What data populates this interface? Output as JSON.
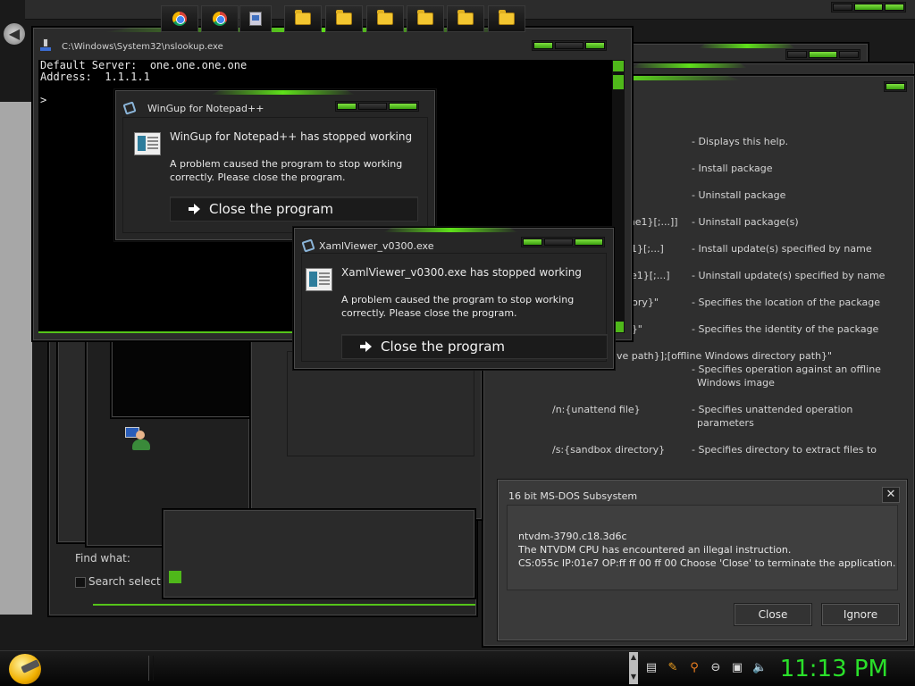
{
  "console": {
    "title": "C:\\Windows\\System32\\nslookup.exe",
    "lines": [
      "Default Server:  one.one.one.one",
      "Address:  1.1.1.1",
      "",
      ">"
    ]
  },
  "dialog1": {
    "title": "WinGup for Notepad++",
    "heading": "WinGup for Notepad++ has stopped working",
    "body1": "A problem caused the program to stop working",
    "body2": "correctly. Please close the program.",
    "button": "Close the program"
  },
  "dialog2": {
    "title": "XamlViewer_v0300.exe",
    "heading": "XamlViewer_v0300.exe has stopped working",
    "body1": "A problem caused the program to stop working",
    "body2": "correctly. Please close the program.",
    "button": "Close the program"
  },
  "help": {
    "rows": [
      {
        "left": "",
        "right": "- Displays this help."
      },
      {
        "left": "",
        "right": "- Install package"
      },
      {
        "left": "",
        "right": "- Uninstall package"
      },
      {
        "left": "me1}[;...]]",
        "right": "- Uninstall package(s)"
      },
      {
        "left": "1}[;...]",
        "right": "- Install update(s) specified by name"
      },
      {
        "left": "e1}[;...]",
        "right": "- Uninstall update(s) specified by name"
      },
      {
        "left": "ectory}\"",
        "right": "- Specifies the location of the package"
      },
      {
        "left": "e}\"",
        "right": "- Specifies the identity of the package"
      }
    ],
    "offline_line": "ve path}];[offline Windows directory path}\"",
    "offline_desc1": "- Specifies operation against an offline",
    "offline_desc2": "Windows image",
    "unattend_left": "/n:{unattend file}",
    "unattend_desc1": "- Specifies unattended operation",
    "unattend_desc2": "parameters",
    "sandbox_left": "/s:{sandbox directory}",
    "sandbox_desc": "- Specifies directory to extract files to"
  },
  "find": {
    "label": "Find what:",
    "checkbox": "Search select"
  },
  "ntvdm": {
    "title": "16 bit MS-DOS Subsystem",
    "line1": "ntvdm-3790.c18.3d6c",
    "line2": "The NTVDM CPU has encountered an illegal instruction.",
    "line3": "CS:055c IP:01e7 OP:ff ff 00 ff 00 Choose 'Close' to terminate the application.",
    "close": "Close",
    "ignore": "Ignore"
  },
  "taskbar": {
    "clock": "11:13 PM",
    "items": [
      "chrome",
      "chrome",
      "app",
      "folder",
      "folder",
      "folder",
      "folder",
      "folder",
      "folder"
    ]
  },
  "colors": {
    "accent": "#55c41a",
    "clock": "#2ae02a"
  }
}
